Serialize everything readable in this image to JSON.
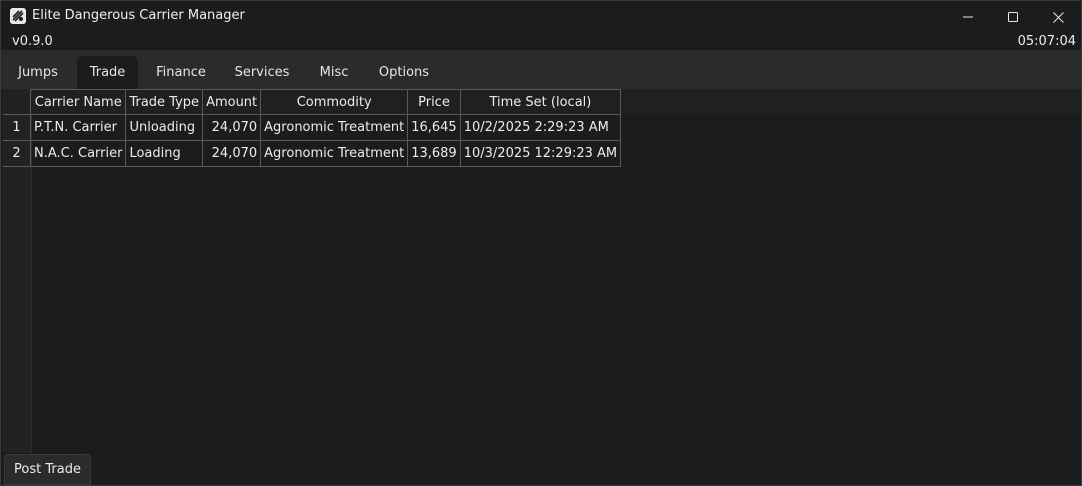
{
  "window": {
    "title": "Elite Dangerous Carrier Manager",
    "version": "v0.9.0",
    "clock": "05:07:04",
    "minimize_icon": "minimize-icon",
    "maximize_icon": "maximize-icon",
    "close_icon": "close-icon"
  },
  "tabs": [
    {
      "label": "Jumps"
    },
    {
      "label": "Trade"
    },
    {
      "label": "Finance"
    },
    {
      "label": "Services"
    },
    {
      "label": "Misc"
    },
    {
      "label": "Options"
    }
  ],
  "active_tab": "Trade",
  "table": {
    "columns": [
      "Carrier Name",
      "Trade Type",
      "Amount",
      "Commodity",
      "Price",
      "Time Set (local)"
    ],
    "rows": [
      {
        "index": "1",
        "carrier": "P.T.N. Carrier",
        "type": "Unloading",
        "amount": "24,070",
        "commodity": "Agronomic Treatment",
        "price": "16,645",
        "time": "10/2/2025 2:29:23 AM"
      },
      {
        "index": "2",
        "carrier": "N.A.C. Carrier",
        "type": "Loading",
        "amount": "24,070",
        "commodity": "Agronomic Treatment",
        "price": "13,689",
        "time": "10/3/2025 12:29:23 AM"
      }
    ]
  },
  "actions": {
    "post_trade": "Post Trade"
  },
  "colors": {
    "background": "#1c1c1e",
    "tabbar": "#2b2b2b",
    "gridline": "#5a5a5a"
  }
}
